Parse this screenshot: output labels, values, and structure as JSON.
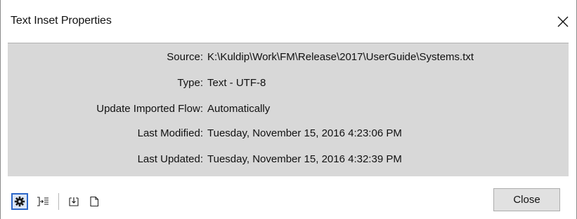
{
  "window": {
    "title": "Text Inset Properties",
    "close_icon": "close-icon"
  },
  "properties": [
    {
      "label": "Source:",
      "value": "K:\\Kuldip\\Work\\FM\\Release\\2017\\UserGuide\\Systems.txt"
    },
    {
      "label": "Type:",
      "value": "Text - UTF-8"
    },
    {
      "label": "Update Imported Flow:",
      "value": "Automatically"
    },
    {
      "label": "Last Modified:",
      "value": "Tuesday, November 15, 2016 4:23:06 PM"
    },
    {
      "label": "Last Updated:",
      "value": "Tuesday, November 15, 2016 4:32:39 PM"
    }
  ],
  "toolbar": {
    "tools": [
      {
        "icon": "settings-gear-icon",
        "selected": true
      },
      {
        "icon": "import-flow-icon",
        "selected": false
      },
      {
        "icon": "update-inset-icon",
        "selected": false
      },
      {
        "icon": "open-source-file-icon",
        "selected": false
      }
    ],
    "close_label": "Close"
  },
  "colors": {
    "panel_background": "#d8d8d8",
    "selected_border": "#2c67c9",
    "selected_fill": "#dce7f7",
    "button_background": "#e1e1e1"
  }
}
